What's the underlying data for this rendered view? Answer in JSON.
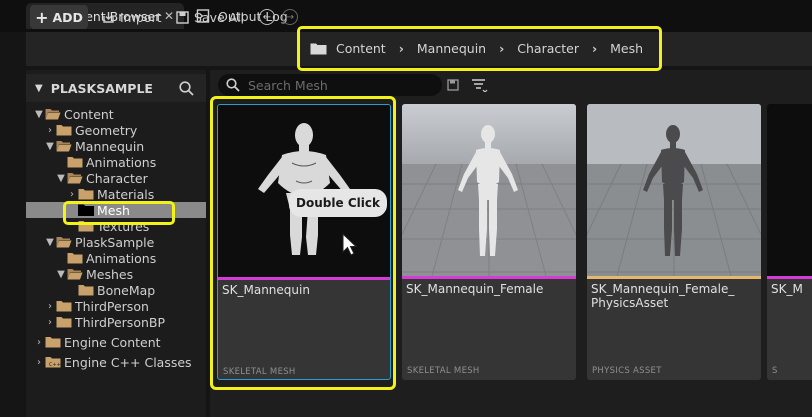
{
  "tabs": [
    {
      "label": "Content Browser",
      "close": "✕"
    },
    {
      "label": "Output Log"
    }
  ],
  "toolbar": {
    "add_label": "ADD",
    "import_label": "Import",
    "save_all_label": "Save All"
  },
  "breadcrumb": [
    "Content",
    "Mannequin",
    "Character",
    "Mesh"
  ],
  "left_panel": {
    "title": "PLASKSAMPLE",
    "tree": [
      {
        "label": "Content",
        "expanded": true
      },
      {
        "label": "Geometry"
      },
      {
        "label": "Mannequin",
        "expanded": true
      },
      {
        "label": "Animations"
      },
      {
        "label": "Character",
        "expanded": true
      },
      {
        "label": "Materials"
      },
      {
        "label": "Mesh",
        "selected": true
      },
      {
        "label": "Textures"
      },
      {
        "label": "PlaskSample",
        "expanded": true
      },
      {
        "label": "Animations"
      },
      {
        "label": "Meshes",
        "expanded": true
      },
      {
        "label": "BoneMap"
      },
      {
        "label": "ThirdPerson"
      },
      {
        "label": "ThirdPersonBP"
      },
      {
        "label": "Engine Content"
      },
      {
        "label": "Engine C++ Classes"
      }
    ]
  },
  "search": {
    "placeholder": "Search Mesh"
  },
  "assets": [
    {
      "name": "SK_Mannequin",
      "type": "SKELETAL MESH",
      "bar_color": "#d63bd6"
    },
    {
      "name": "SK_Mannequin_Female",
      "type": "SKELETAL MESH",
      "bar_color": "#d63bd6"
    },
    {
      "name": "SK_Mannequin_Female_\nPhysicsAsset",
      "type": "PHYSICS ASSET",
      "bar_color": "#e6b86a"
    },
    {
      "name": "SK_M",
      "type": "S",
      "bar_color": "#d63bd6"
    }
  ],
  "tooltip": "Double Click",
  "colors": {
    "highlight": "#f2f21a",
    "accent_folder": "#c8a26a"
  }
}
